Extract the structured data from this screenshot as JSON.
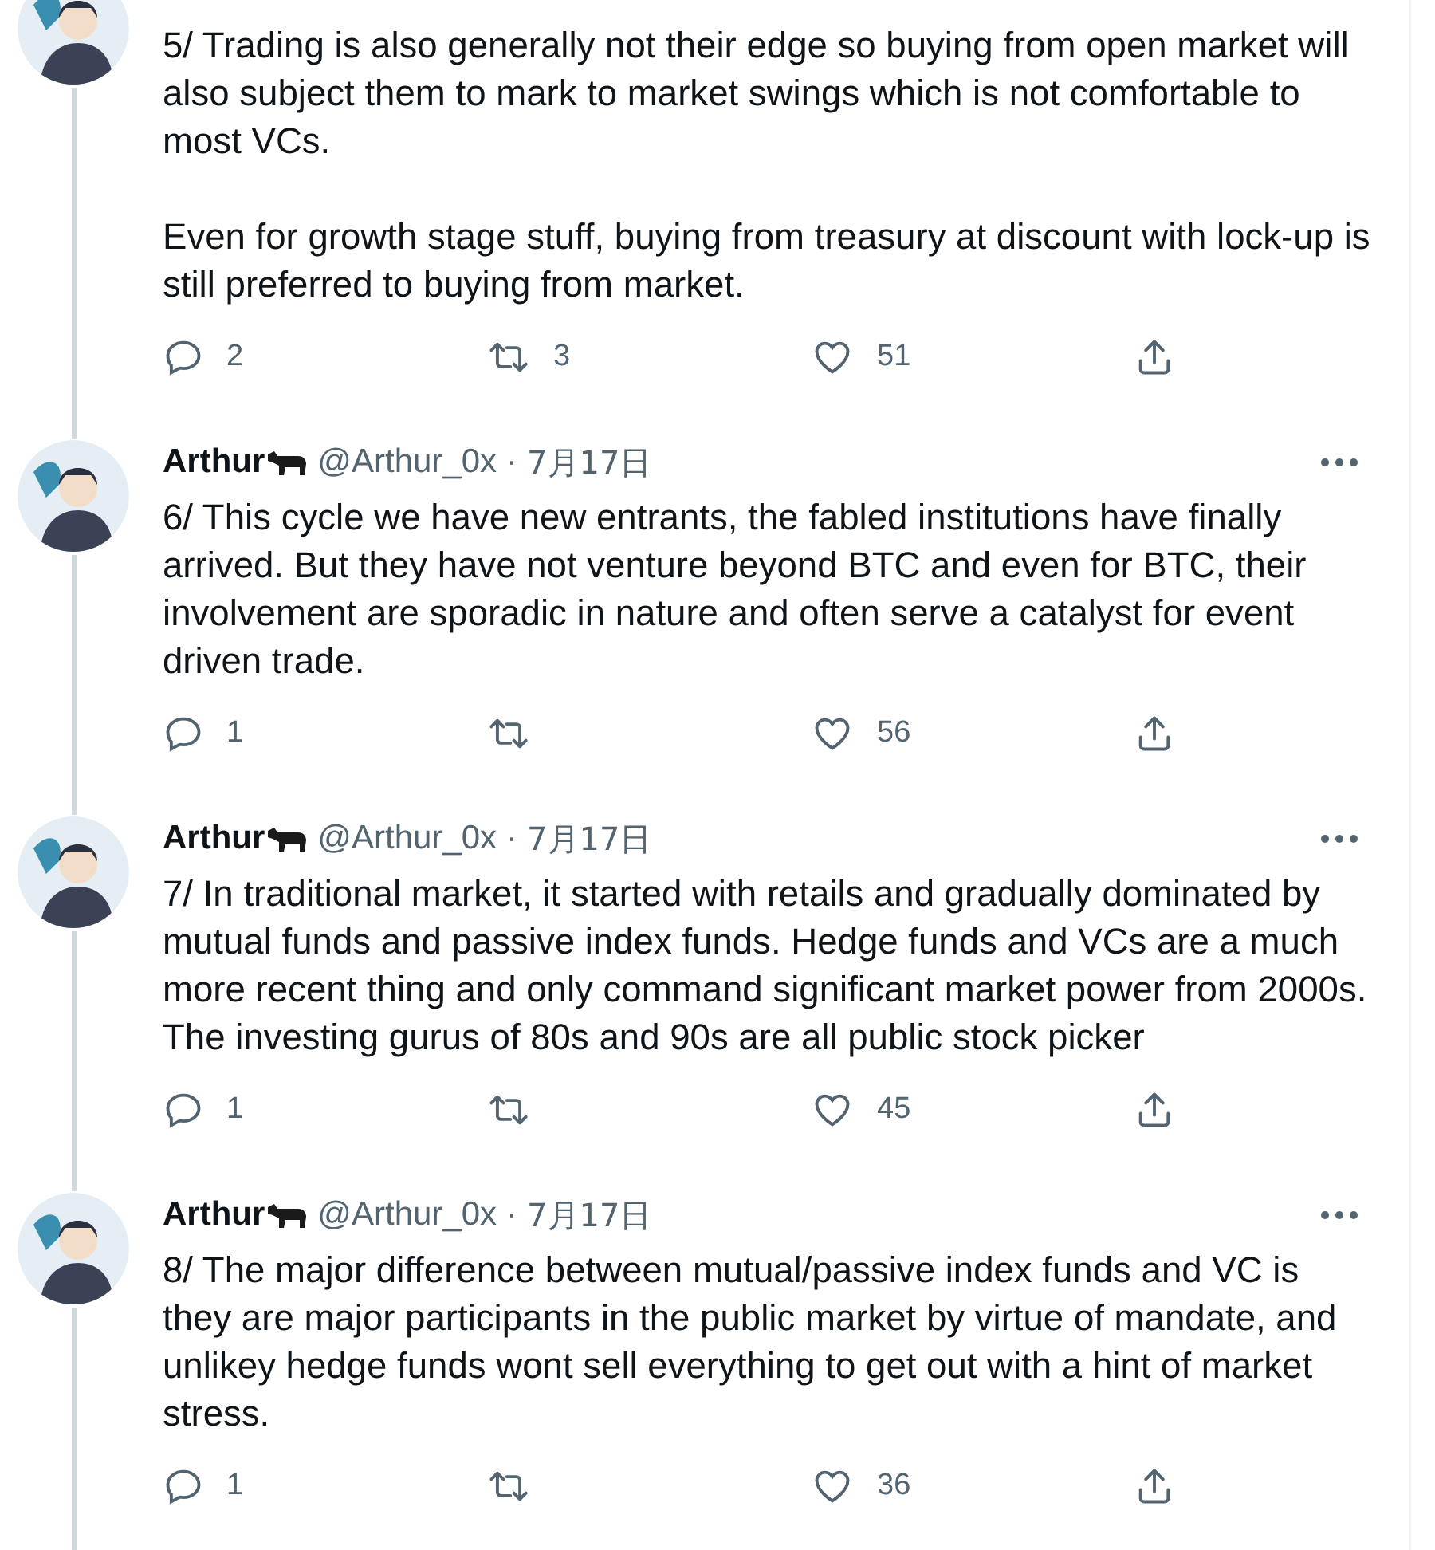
{
  "tweets": [
    {
      "paragraphs": [
        "5/ Trading is also generally not their edge so buying from open market will also subject them to mark to market swings which is not comfortable to most VCs.",
        "Even for growth stage stuff, buying from treasury at discount with lock-up is still preferred to buying from market."
      ],
      "replies": "2",
      "retweets": "3",
      "likes": "51"
    },
    {
      "header": {
        "name": "Arthur",
        "handle": "@Arthur_0x",
        "separator": "·",
        "date": "7月17日"
      },
      "paragraphs": [
        "6/ This cycle we have new entrants, the fabled institutions have finally arrived. But they have not venture beyond BTC and even for BTC, their involvement are sporadic in nature and often serve a catalyst for event driven trade."
      ],
      "replies": "1",
      "likes": "56"
    },
    {
      "header": {
        "name": "Arthur",
        "handle": "@Arthur_0x",
        "separator": "·",
        "date": "7月17日"
      },
      "paragraphs": [
        "7/ In traditional market, it started with retails and gradually dominated by mutual funds and passive index funds. Hedge funds and VCs are a much more recent thing and only command significant market power from 2000s. The investing gurus of 80s and 90s are all public stock picker"
      ],
      "replies": "1",
      "likes": "45"
    },
    {
      "header": {
        "name": "Arthur",
        "handle": "@Arthur_0x",
        "separator": "·",
        "date": "7月17日"
      },
      "paragraphs": [
        "8/ The major difference between mutual/passive index funds and VC is they are major participants in the public market by virtue of mandate, and unlikey hedge funds wont sell everything to get out with a hint of market stress."
      ],
      "replies": "1",
      "likes": "36"
    }
  ]
}
